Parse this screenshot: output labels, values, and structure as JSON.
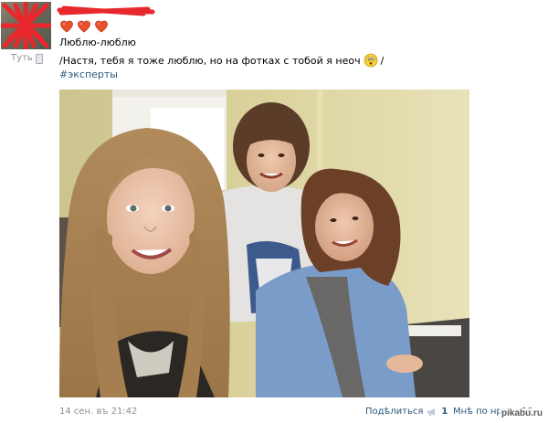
{
  "author": {
    "label": "Туть"
  },
  "post": {
    "line1": "Люблю-люблю",
    "line2": "/Настя, тебя я тоже люблю, но на фотках с тобой я неоч",
    "line2_suffix": "/",
    "hashtag": "#эксперты",
    "emoji": "face-with-open-mouth-emoji",
    "hearts_count": 3
  },
  "footer": {
    "date": "14 сен. въ 21:42",
    "share_label": "Подѣлиться",
    "share_count": "1",
    "like_label": "Мнѣ по нраву 10"
  },
  "watermark": "pikabu.ru",
  "colors": {
    "link": "#2b587a",
    "meta": "#8a8f99",
    "heart": "#e8502e",
    "redact": "#e8282c"
  }
}
